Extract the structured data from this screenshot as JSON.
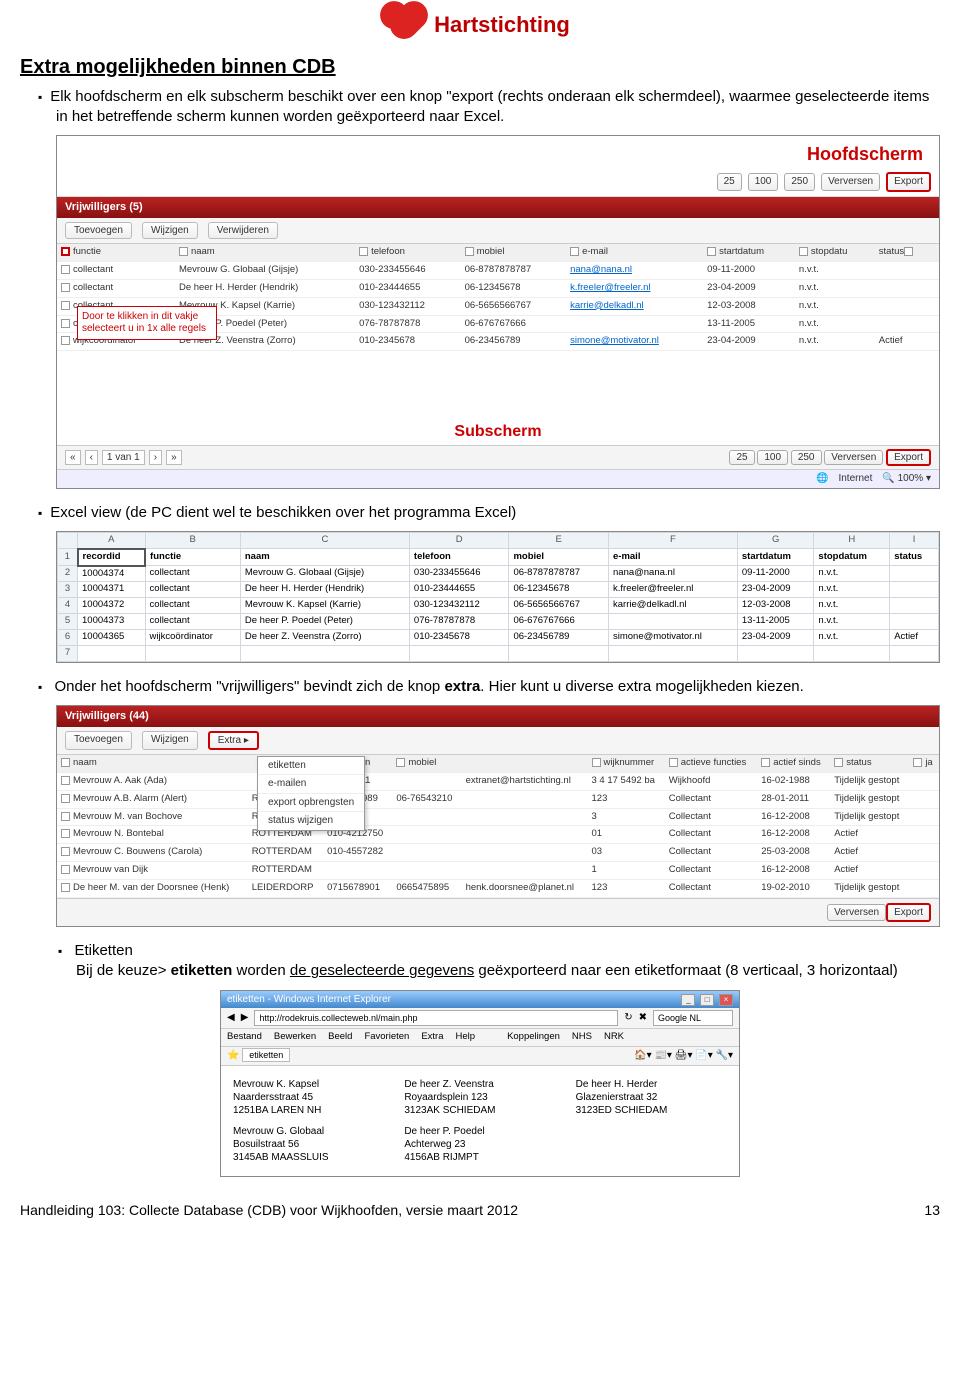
{
  "logo_text": "Hartstichting",
  "section_title": "Extra mogelijkheden binnen CDB",
  "bullets": {
    "export_intro": "Elk hoofdscherm en elk subscherm beschikt over een knop \"export (rechts onderaan elk schermdeel), waarmee geselecteerde items in het betreffende scherm kunnen worden geëxporteerd naar Excel.",
    "excel_view": "Excel view (de PC dient wel te beschikken over het programma Excel)",
    "extra_knop_a": "Onder het hoofdscherm \"vrijwilligers\" bevindt zich de knop ",
    "extra_knop_b": "extra",
    "extra_knop_c": ". Hier kunt u diverse extra mogelijkheden kiezen.",
    "etiketten_title": "Etiketten",
    "etiketten_text_a": "Bij de keuze> ",
    "etiketten_text_b": "etiketten",
    "etiketten_text_c": " worden ",
    "etiketten_text_d": "de geselecteerde gegevens",
    "etiketten_text_e": " geëxporteerd naar een etiketformaat (8 verticaal, 3 horizontaal)"
  },
  "shot1": {
    "hoofdscherm": "Hoofdscherm",
    "subscherm": "Subscherm",
    "page_sizes": [
      "25",
      "100",
      "250"
    ],
    "refresh": "Verversen",
    "export": "Export",
    "vrij_title": "Vrijwilligers (5)",
    "actions": [
      "Toevoegen",
      "Wijzigen",
      "Verwijderen"
    ],
    "cols": [
      "functie",
      "naam",
      "telefoon",
      "mobiel",
      "e-mail",
      "startdatum",
      "stopdatu",
      "status"
    ],
    "rows": [
      [
        "collectant",
        "Mevrouw G. Globaal (Gijsje)",
        "030-233455646",
        "06-8787878787",
        "nana@nana.nl",
        "09-11-2000",
        "n.v.t.",
        ""
      ],
      [
        "collectant",
        "De heer H. Herder (Hendrik)",
        "010-23444655",
        "06-12345678",
        "k.freeler@freeler.nl",
        "23-04-2009",
        "n.v.t.",
        ""
      ],
      [
        "collectant",
        "Mevrouw K. Kapsel (Karrie)",
        "030-123432112",
        "06-5656566767",
        "karrie@delkadl.nl",
        "12-03-2008",
        "n.v.t.",
        ""
      ],
      [
        "collectant",
        "De heer P. Poedel (Peter)",
        "076-78787878",
        "06-676767666",
        "",
        "13-11-2005",
        "n.v.t.",
        ""
      ],
      [
        "wijkcoördinator",
        "De heer Z. Veenstra (Zorro)",
        "010-2345678",
        "06-23456789",
        "simone@motivator.nl",
        "23-04-2009",
        "n.v.t.",
        "Actief"
      ]
    ],
    "note": "Door te klikken in dit vakje selecteert u in 1x alle regels",
    "pager": "1 van 1",
    "status_internet": "Internet",
    "zoom": "100%"
  },
  "excel": {
    "col_letters": [
      "A",
      "B",
      "C",
      "D",
      "E",
      "F",
      "G",
      "H",
      "I"
    ],
    "headers": [
      "recordid",
      "functie",
      "naam",
      "telefoon",
      "mobiel",
      "e-mail",
      "startdatum",
      "stopdatum",
      "status"
    ],
    "rows": [
      [
        "10004374",
        "collectant",
        "Mevrouw G. Globaal (Gijsje)",
        "030-233455646",
        "06-8787878787",
        "nana@nana.nl",
        "09-11-2000",
        "n.v.t.",
        ""
      ],
      [
        "10004371",
        "collectant",
        "De heer H. Herder (Hendrik)",
        "010-23444655",
        "06-12345678",
        "k.freeler@freeler.nl",
        "23-04-2009",
        "n.v.t.",
        ""
      ],
      [
        "10004372",
        "collectant",
        "Mevrouw K. Kapsel (Karrie)",
        "030-123432112",
        "06-5656566767",
        "karrie@delkadl.nl",
        "12-03-2008",
        "n.v.t.",
        ""
      ],
      [
        "10004373",
        "collectant",
        "De heer P. Poedel (Peter)",
        "076-78787878",
        "06-676767666",
        "",
        "13-11-2005",
        "n.v.t.",
        ""
      ],
      [
        "10004365",
        "wijkcoördinator",
        "De heer Z. Veenstra (Zorro)",
        "010-2345678",
        "06-23456789",
        "simone@motivator.nl",
        "23-04-2009",
        "n.v.t.",
        "Actief"
      ]
    ]
  },
  "shot3": {
    "vrij_title": "Vrijwilligers (44)",
    "actions": [
      "Toevoegen",
      "Wijzigen",
      "Extra"
    ],
    "extra_menu": [
      "etiketten",
      "e-mailen",
      "export opbrengsten",
      "status wijzigen"
    ],
    "cols": [
      "naam",
      "",
      "elefoon",
      "mobiel",
      "",
      "wijknummer",
      "actieve functies",
      "actief sinds",
      "status",
      "ja"
    ],
    "rows": [
      [
        "Mevrouw A. Aak (Ada)",
        "",
        "101111111",
        "",
        "extranet@hartstichting.nl",
        "3 4 17 5492 ba",
        "Wijkhoofd",
        "16-02-1988",
        "Tijdelijk gestopt",
        ""
      ],
      [
        "Mevrouw A.B. Alarm (Alert)",
        "ROTTERDAM",
        "20-9898989",
        "06-76543210",
        "",
        "123",
        "Collectant",
        "28-01-2011",
        "Tijdelijk gestopt",
        ""
      ],
      [
        "Mevrouw M. van Bochove",
        "ROTTERDAM",
        "",
        "",
        "",
        "3",
        "Collectant",
        "16-12-2008",
        "Tijdelijk gestopt",
        ""
      ],
      [
        "Mevrouw N. Bontebal",
        "ROTTERDAM",
        "010-4212750",
        "",
        "",
        "01",
        "Collectant",
        "16-12-2008",
        "Actief",
        ""
      ],
      [
        "Mevrouw C. Bouwens (Carola)",
        "ROTTERDAM",
        "010-4557282",
        "",
        "",
        "03",
        "Collectant",
        "25-03-2008",
        "Actief",
        ""
      ],
      [
        "Mevrouw van Dijk",
        "ROTTERDAM",
        "",
        "",
        "",
        "1",
        "Collectant",
        "16-12-2008",
        "Actief",
        ""
      ],
      [
        "De heer M. van der Doorsnee (Henk)",
        "LEIDERDORP",
        "0715678901",
        "0665475895",
        "henk.doorsnee@planet.nl",
        "123",
        "Collectant",
        "19-02-2010",
        "Tijdelijk gestopt",
        ""
      ]
    ],
    "refresh": "Verversen",
    "export": "Export"
  },
  "ie": {
    "title": "etiketten - Windows Internet Explorer",
    "url": "http://rodekruis.collecteweb.nl/main.php",
    "search_ph": "Google NL",
    "menus": [
      "Bestand",
      "Bewerken",
      "Beeld",
      "Favorieten",
      "Extra",
      "Help"
    ],
    "koppelingen": "Koppelingen",
    "tab": "etiketten",
    "nhs": "NHS",
    "nrk": "NRK",
    "labels": [
      {
        "n": "Mevrouw K. Kapsel",
        "a": "Naardersstraat 45",
        "p": "1251BA LAREN NH"
      },
      {
        "n": "De heer Z. Veenstra",
        "a": "Royaardsplein 123",
        "p": "3123AK SCHIEDAM"
      },
      {
        "n": "De heer H. Herder",
        "a": "Glazenierstraat 32",
        "p": "3123ED SCHIEDAM"
      },
      {
        "n": "Mevrouw G. Globaal",
        "a": "Bosuilstraat 56",
        "p": "3145AB MAASSLUIS"
      },
      {
        "n": "De heer P. Poedel",
        "a": "Achterweg 23",
        "p": "4156AB RIJMPT"
      },
      {
        "n": "",
        "a": "",
        "p": ""
      }
    ]
  },
  "footer": {
    "text": "Handleiding 103: Collecte Database (CDB) voor Wijkhoofden, versie maart 2012",
    "page": "13"
  }
}
